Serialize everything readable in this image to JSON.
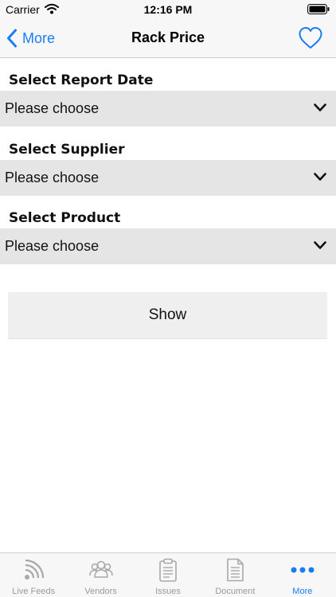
{
  "status_bar": {
    "carrier": "Carrier",
    "time": "12:16 PM"
  },
  "nav": {
    "back_label": "More",
    "title": "Rack Price"
  },
  "form": {
    "fields": [
      {
        "label": "Select Report Date",
        "value": "Please choose"
      },
      {
        "label": "Select Supplier",
        "value": "Please choose"
      },
      {
        "label": "Select Product",
        "value": "Please choose"
      }
    ],
    "show_label": "Show"
  },
  "tabs": [
    {
      "label": "Live Feeds",
      "icon": "rss-feed-icon",
      "active": false
    },
    {
      "label": "Vendors",
      "icon": "users-group-icon",
      "active": false
    },
    {
      "label": "Issues",
      "icon": "clipboard-icon",
      "active": false
    },
    {
      "label": "Document",
      "icon": "document-icon",
      "active": false
    },
    {
      "label": "More",
      "icon": "more-dots-icon",
      "active": true
    }
  ],
  "colors": {
    "accent": "#1a7cf5",
    "inactive_tab": "#9a9a9a",
    "select_background": "#e5e5e5",
    "button_background": "#efefef"
  }
}
